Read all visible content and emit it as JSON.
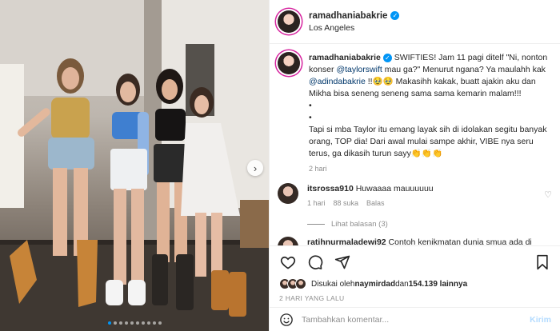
{
  "post": {
    "author": "ramadhaniabakrie",
    "location": "Los Angeles",
    "carousel": {
      "total": 10,
      "active": 0
    }
  },
  "caption": {
    "author": "ramadhaniabakrie",
    "text_1": " SWIFTIES! Jam 11 pagi ditelf \"Ni, nonton konser ",
    "mention_1": "@taylorswift",
    "text_2": " mau ga?\" Menurut ngana? Ya maulahh kak ",
    "mention_2": "@adindabakrie",
    "text_3": " !!🥹🥹 Makasihh kakak, buatt ajakin aku dan Mikha bisa seneng seneng sama sama kemarin malam!!!",
    "bullet_1": "•",
    "bullet_2": "•",
    "text_4": "Tapi si mba Taylor itu emang layak sih di idolakan segitu banyak orang, TOP dia! Dari awal mulai sampe akhir, VIBE nya seru terus, ga dikasih turun sayy👏👏👏",
    "age": "2 hari"
  },
  "comments": [
    {
      "user": "itsrossa910",
      "text": " Huwaaaa mauuuuuu",
      "age": "1 hari",
      "likes": "88 suka",
      "reply": "Balas",
      "view_replies": "Lihat balasan (3)"
    },
    {
      "user": "ratihnurmaladewi92",
      "text": " Contoh kenikmatan dunia smua ada di"
    }
  ],
  "actions": {
    "icons": [
      "heart-outline-icon",
      "comment-icon",
      "share-icon",
      "bookmark-icon"
    ]
  },
  "likes": {
    "prefix": "Disukai oleh ",
    "user": "naymirdad",
    "middle": " dan ",
    "count": "154.139 lainnya"
  },
  "date": "2 HARI YANG LALU",
  "composer": {
    "placeholder": "Tambahkan komentar...",
    "post_label": "Kirim"
  },
  "colors": {
    "accent": "#0095f6",
    "text": "#262626",
    "muted": "#8e8e8e",
    "link": "#00376b"
  }
}
